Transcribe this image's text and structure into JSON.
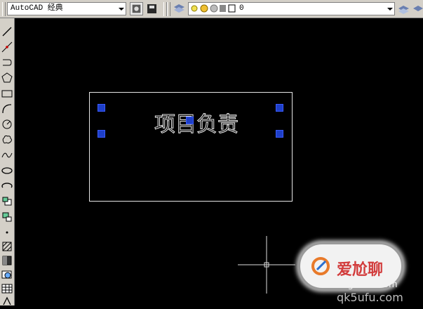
{
  "toolbar": {
    "workspace_value": "AutoCAD 经典",
    "layer_value": "0"
  },
  "canvas": {
    "mtext": "项目负责"
  },
  "watermark": {
    "brand": "爱尬聊",
    "url": "igaliao.com",
    "footer": "qk5ufu.com"
  },
  "icons": [
    "line-icon",
    "construction-line-icon",
    "polyline-icon",
    "polygon-icon",
    "rectangle-icon",
    "arc-icon",
    "circle-icon",
    "revision-cloud-icon",
    "spline-icon",
    "ellipse-icon",
    "ellipse-arc-icon",
    "insert-block-icon",
    "make-block-icon",
    "point-icon",
    "hatch-icon",
    "gradient-icon",
    "region-icon",
    "table-icon"
  ],
  "colors": {
    "toolbar_bg": "#d4d0c8",
    "grip": "#1e3fc8",
    "canvas_bg": "#000000"
  }
}
